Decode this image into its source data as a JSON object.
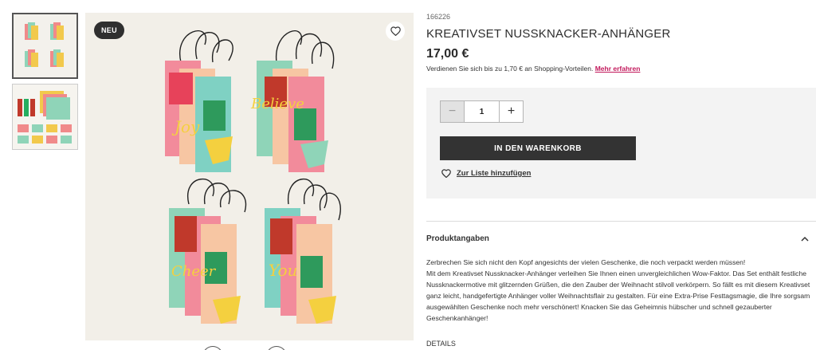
{
  "gallery": {
    "badge": "NEU",
    "thumbnails": [
      {
        "label": "Gallery image 1",
        "active": true
      },
      {
        "label": "Gallery image 2",
        "active": false
      }
    ]
  },
  "product": {
    "sku": "166226",
    "title": "KREATIVSET NUSSKNACKER-ANHÄNGER",
    "price": "17,00 €",
    "earn_text": "Verdienen Sie sich bis zu 1,70 € an Shopping-Vorteilen.",
    "earn_link": "Mehr erfahren"
  },
  "purchase": {
    "quantity": "1",
    "minus_symbol": "−",
    "plus_symbol": "+",
    "cart_label": "IN DEN WARENKORB",
    "wishlist_label": "Zur Liste hinzufügen"
  },
  "info": {
    "section_title": "Produktangaben",
    "description_lines": [
      "Zerbrechen Sie sich nicht den Kopf angesichts der vielen Geschenke, die noch verpackt werden müssen!",
      "Mit dem Kreativset Nussknacker-Anhänger verleihen Sie Ihnen einen unvergleichlichen Wow-Faktor. Das Set enthält festliche Nussknackermotive mit glitzernden Grüßen, die den Zauber der Weihnacht stilvoll verkörpern. So fällt es mit diesem Kreativset ganz leicht, handgefertigte Anhänger voller Weihnachtsflair zu gestalten. Für eine Extra-Prise Festtagsmagie, die Ihre sorgsam ausgewählten Geschenke noch mehr verschönert! Knacken Sie das Geheimnis hübscher und schnell gezauberter Geschenkanhänger!"
    ],
    "details_label": "DETAILS"
  },
  "colors": {
    "accent_link": "#c2185b",
    "button_dark": "#333333",
    "panel_bg": "#f3f3f3"
  }
}
